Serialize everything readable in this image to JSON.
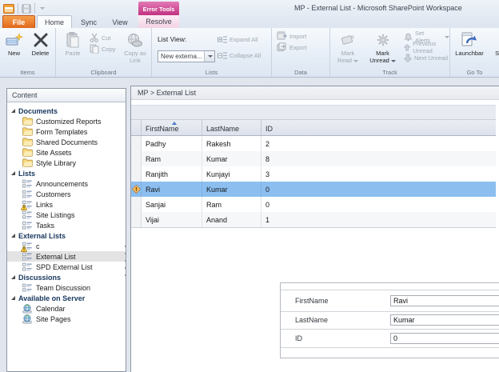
{
  "window": {
    "title": "MP - External List -  Microsoft SharePoint Workspace"
  },
  "error_tools": {
    "label": "Error Tools"
  },
  "tabs": {
    "file": "File",
    "home": "Home",
    "sync": "Sync",
    "view": "View",
    "resolve": "Resolve"
  },
  "ribbon": {
    "items": {
      "label": "Items",
      "new": "New",
      "delete": "Delete"
    },
    "clipboard": {
      "label": "Clipboard",
      "paste": "Paste",
      "cut": "Cut",
      "copy": "Copy",
      "copy_as_link": "Copy as Link"
    },
    "lists": {
      "label": "Lists",
      "list_view": "List View:",
      "list_view_value": "New externa...",
      "expand_all": "Expand All",
      "collapse_all": "Collapse All"
    },
    "data": {
      "label": "Data",
      "import": "Import",
      "export": "Export"
    },
    "track": {
      "label": "Track",
      "mark_read": "Mark Read",
      "mark_unread": "Mark Unread",
      "set_alerts": "Set Alerts",
      "previous_unread": "Previous Unread",
      "next_unread": "Next Unread"
    },
    "goto": {
      "label": "Go To",
      "launchbar": "Launchbar",
      "search": "Search"
    }
  },
  "sidebar": {
    "header": "Content",
    "tree": [
      {
        "label": "Documents",
        "type": "section"
      },
      {
        "label": "Customized Reports",
        "type": "folder"
      },
      {
        "label": "Form Templates",
        "type": "folder"
      },
      {
        "label": "Shared Documents",
        "type": "folder"
      },
      {
        "label": "Site Assets",
        "type": "folder"
      },
      {
        "label": "Style Library",
        "type": "folder"
      },
      {
        "label": "Lists",
        "type": "section"
      },
      {
        "label": "Announcements",
        "type": "list"
      },
      {
        "label": "Customers",
        "type": "list"
      },
      {
        "label": "Links",
        "type": "list-warning"
      },
      {
        "label": "Site Listings",
        "type": "list"
      },
      {
        "label": "Tasks",
        "type": "list"
      },
      {
        "label": "External Lists",
        "type": "section"
      },
      {
        "label": "c",
        "type": "list-warning"
      },
      {
        "label": "External List",
        "type": "list",
        "selected": true
      },
      {
        "label": "SPD External List",
        "type": "list"
      },
      {
        "label": "Discussions",
        "type": "section"
      },
      {
        "label": "Team Discussion",
        "type": "list"
      },
      {
        "label": "Available on Server",
        "type": "section"
      },
      {
        "label": "Calendar",
        "type": "server"
      },
      {
        "label": "Site Pages",
        "type": "server"
      }
    ]
  },
  "main": {
    "breadcrumb": "MP > External List",
    "table": {
      "columns": [
        "FirstName",
        "LastName",
        "ID"
      ],
      "sort": {
        "column": "FirstName",
        "direction": "asc"
      },
      "rows": [
        {
          "FirstName": "Padhy",
          "LastName": "Rakesh",
          "ID": "2"
        },
        {
          "FirstName": "Ram",
          "LastName": "Kumar",
          "ID": "8"
        },
        {
          "FirstName": "Ranjith",
          "LastName": "Kunjayi",
          "ID": "3"
        },
        {
          "FirstName": "Ravi",
          "LastName": "Kumar",
          "ID": "0",
          "selected": true,
          "warning": true
        },
        {
          "FirstName": "Sanjai",
          "LastName": "Ram",
          "ID": "0"
        },
        {
          "FirstName": "Vijai",
          "LastName": "Anand",
          "ID": "1"
        }
      ]
    },
    "detail_form": {
      "fields": [
        {
          "label": "FirstName",
          "value": "Ravi"
        },
        {
          "label": "LastName",
          "value": "Kumar"
        },
        {
          "label": "ID",
          "value": "0"
        }
      ]
    }
  },
  "colors": {
    "selection_blue": "#8CBFF0",
    "error_tools_magenta": "#BF2E7E",
    "file_tab_orange": "#E2671C",
    "section_navy": "#17365D",
    "warning_orange": "#F2A93B"
  }
}
